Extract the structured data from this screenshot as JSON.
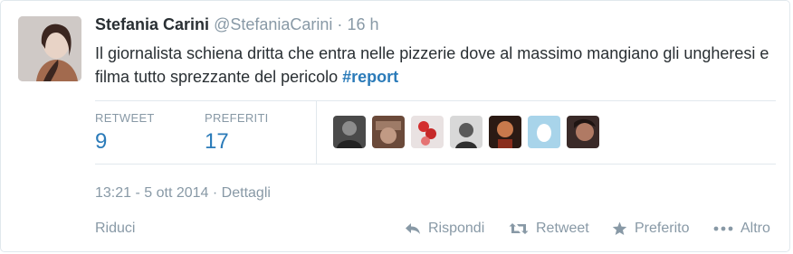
{
  "tweet": {
    "name": "Stefania Carini",
    "handle": "@StefaniaCarini",
    "separator": "·",
    "time": "16 h",
    "text_main": "Il giornalista schiena dritta che entra nelle pizzerie dove al massimo mangiano gli ungheresi e filma tutto sprezzante del pericolo ",
    "hashtag": "#report"
  },
  "stats": {
    "retweet_label": "RETWEET",
    "retweet_count": "9",
    "favorites_label": "PREFERITI",
    "favorites_count": "17"
  },
  "favoriters": [
    "avatar-1",
    "avatar-2",
    "avatar-3",
    "avatar-4",
    "avatar-5",
    "avatar-6",
    "avatar-7"
  ],
  "meta": {
    "timestamp": "13:21 - 5 ott 2014",
    "separator": "·",
    "details_link": "Dettagli"
  },
  "footer": {
    "collapse_label": "Riduci",
    "reply_label": "Rispondi",
    "retweet_label": "Retweet",
    "favorite_label": "Preferito",
    "more_label": "Altro",
    "reply_icon": "reply-icon",
    "retweet_icon": "retweet-icon",
    "favorite_icon": "star-icon",
    "more_icon": "more-dots-icon"
  },
  "colors": {
    "link": "#2b7bb9",
    "muted": "#8899a6",
    "text": "#292f33",
    "border": "#e1e8ed"
  }
}
